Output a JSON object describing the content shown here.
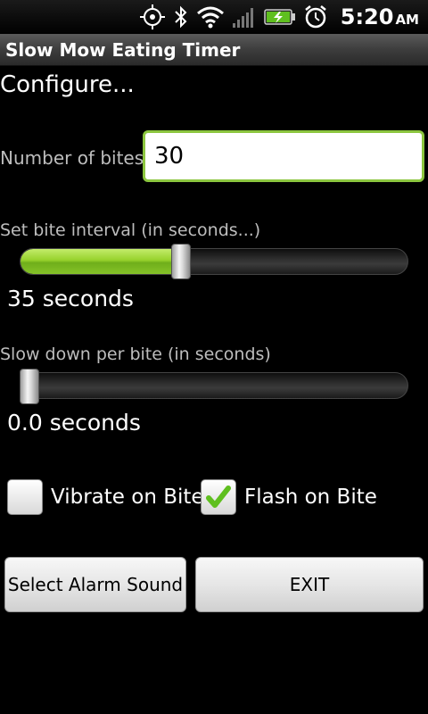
{
  "status_bar": {
    "time": "5:20",
    "ampm": "AM",
    "icons": [
      "gps-icon",
      "bluetooth-icon",
      "wifi-icon",
      "signal-icon",
      "battery-charging-icon",
      "alarm-icon"
    ]
  },
  "app": {
    "title": "Slow Mow Eating Timer",
    "heading": "Configure..."
  },
  "bites": {
    "label": "Number of bites:",
    "value": "30"
  },
  "bite_interval": {
    "label": "Set bite interval (in seconds...)",
    "value_text": "35 seconds",
    "fraction": 0.41
  },
  "slow_down": {
    "label": "Slow down per bite (in seconds)",
    "value_text": "0.0 seconds",
    "fraction": 0.0
  },
  "options": {
    "vibrate_label": "Vibrate on Bite",
    "vibrate_checked": false,
    "flash_label": "Flash on Bite",
    "flash_checked": true
  },
  "buttons": {
    "alarm_label": "Select Alarm Sound",
    "exit_label": "EXIT"
  },
  "colors": {
    "accent_green": "#8cc63f",
    "background": "#000000"
  }
}
